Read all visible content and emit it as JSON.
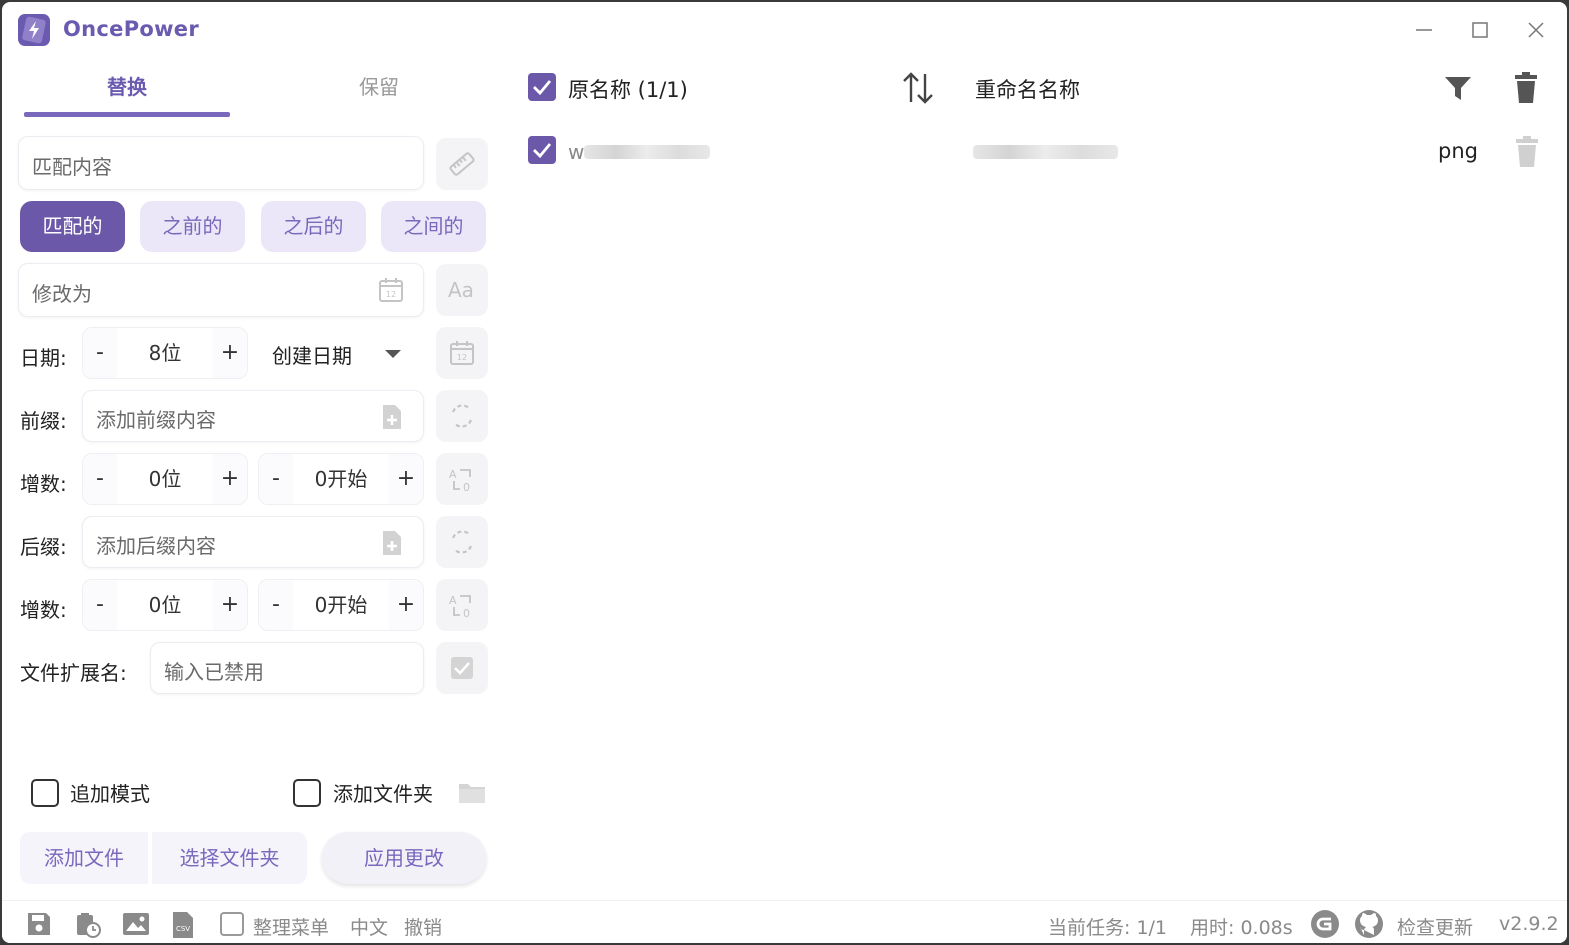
{
  "app": {
    "title": "OncePower",
    "accent": "#6b58a8"
  },
  "tabs": {
    "replace": "替换",
    "keep": "保留"
  },
  "match": {
    "placeholder": "匹配内容"
  },
  "modes": [
    "匹配的",
    "之前的",
    "之后的",
    "之间的"
  ],
  "modify": {
    "placeholder": "修改为"
  },
  "date": {
    "label": "日期:",
    "minus": "-",
    "plus": "+",
    "value": "8位",
    "type": "创建日期"
  },
  "prefix": {
    "label": "前缀:",
    "placeholder": "添加前缀内容"
  },
  "prefix_counter": {
    "label": "增数:",
    "digits": "0位",
    "start": "0开始",
    "minus": "-",
    "plus": "+"
  },
  "suffix": {
    "label": "后缀:",
    "placeholder": "添加后缀内容"
  },
  "suffix_counter": {
    "label": "增数:",
    "digits": "0位",
    "start": "0开始",
    "minus": "-",
    "plus": "+"
  },
  "extension": {
    "label": "文件扩展名:",
    "placeholder": "输入已禁用"
  },
  "options": {
    "append_mode": "追加模式",
    "add_folder": "添加文件夹"
  },
  "actions": {
    "add_files": "添加文件",
    "select_folder": "选择文件夹",
    "apply": "应用更改"
  },
  "list": {
    "header_original": "原名称 (1/1)",
    "header_renamed": "重命名名称",
    "rows": [
      {
        "original": "w",
        "ext": "png"
      }
    ]
  },
  "status": {
    "organize_menu": "整理菜单",
    "language": "中文",
    "undo": "撤销",
    "task": "当前任务: 1/1",
    "time": "用时: 0.08s",
    "check_update": "检查更新",
    "version": "v2.9.2"
  }
}
